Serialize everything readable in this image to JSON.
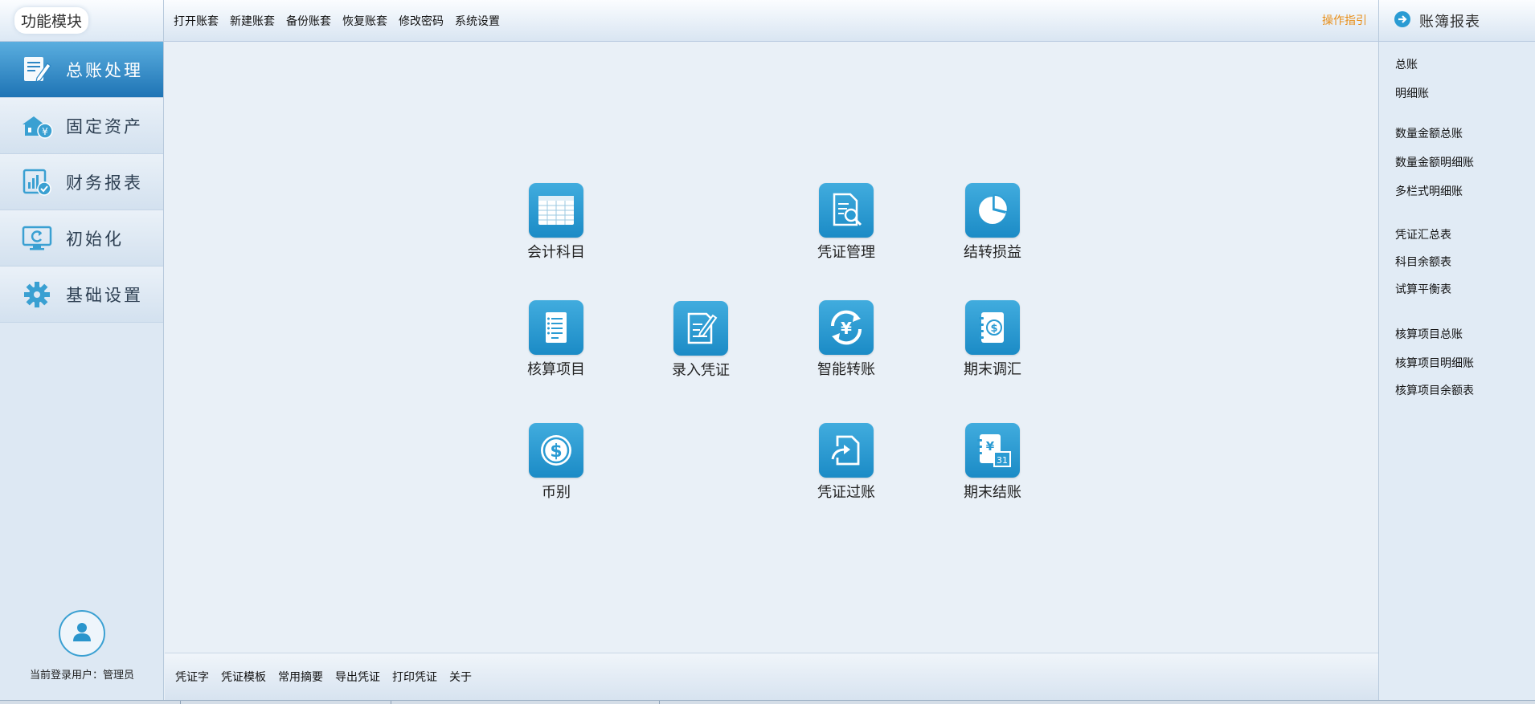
{
  "sidebar": {
    "header": "功能模块",
    "items": [
      {
        "label": "总账处理",
        "icon": "ledger-edit-icon",
        "active": true
      },
      {
        "label": "固定资产",
        "icon": "asset-house-yen-icon",
        "active": false
      },
      {
        "label": "财务报表",
        "icon": "report-check-icon",
        "active": false
      },
      {
        "label": "初始化",
        "icon": "monitor-refresh-icon",
        "active": false
      },
      {
        "label": "基础设置",
        "icon": "gear-icon",
        "active": false
      }
    ],
    "user_label": "当前登录用户：管理员"
  },
  "topbar": {
    "menus": [
      "打开账套",
      "新建账套",
      "备份账套",
      "恢复账套",
      "修改密码",
      "系统设置"
    ],
    "guide": "操作指引"
  },
  "right_panel": {
    "title": "账簿报表",
    "links": [
      "总账",
      "明细账",
      "数量金额总账",
      "数量金额明细账",
      "多栏式明细账",
      "凭证汇总表",
      "科目余额表",
      "试算平衡表",
      "核算项目总账",
      "核算项目明细账",
      "核算项目余额表"
    ]
  },
  "tiles": [
    {
      "label": "会计科目",
      "icon": "spreadsheet-icon"
    },
    {
      "label": "凭证管理",
      "icon": "document-search-icon"
    },
    {
      "label": "结转损益",
      "icon": "pie-chart-icon"
    },
    {
      "label": "核算项目",
      "icon": "notepad-icon"
    },
    {
      "label": "录入凭证",
      "icon": "document-edit-icon"
    },
    {
      "label": "智能转账",
      "icon": "yen-cycle-icon"
    },
    {
      "label": "期末调汇",
      "icon": "dollar-notebook-icon"
    },
    {
      "label": "币别",
      "icon": "dollar-coin-icon"
    },
    {
      "label": "凭证过账",
      "icon": "export-document-icon"
    },
    {
      "label": "期末结账",
      "icon": "yen-calendar-icon"
    }
  ],
  "calendar_day": "31",
  "bottombar": {
    "menus": [
      "凭证字",
      "凭证模板",
      "常用摘要",
      "导出凭证",
      "打印凭证",
      "关于"
    ]
  },
  "colors": {
    "accent": "#2196d0",
    "active_nav": "#1f74b5",
    "guide": "#e88f1a",
    "background": "#e9f0f7"
  }
}
